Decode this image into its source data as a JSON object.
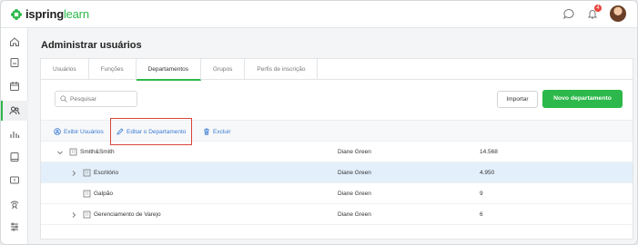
{
  "brand": {
    "word1": "ispring",
    "word2": "learn"
  },
  "header": {
    "notification_count": "4"
  },
  "page": {
    "title": "Administrar usuários"
  },
  "tabs": [
    {
      "label": "Usuários"
    },
    {
      "label": "Funções"
    },
    {
      "label": "Departamentos"
    },
    {
      "label": "Grupos"
    },
    {
      "label": "Perfis de inscrição"
    }
  ],
  "toolbar": {
    "search_placeholder": "Pesquisar",
    "import_label": "Importar",
    "new_department_label": "Novo departamento"
  },
  "actions": {
    "view_users": "Exibir Usuários",
    "edit_department": "Editar o Departamento",
    "delete": "Excluir"
  },
  "rows": [
    {
      "name": "Smith&Smith",
      "manager": "Diane Green",
      "count": "14.568"
    },
    {
      "name": "Escritório",
      "manager": "Diane Green",
      "count": "4.950"
    },
    {
      "name": "Galpão",
      "manager": "Diane Green",
      "count": "9"
    },
    {
      "name": "Gerenciamento de Varejo",
      "manager": "Diane Green",
      "count": "6"
    }
  ],
  "colors": {
    "accent": "#2cb84a",
    "link": "#3a7bd5",
    "highlight_border": "#d9443d",
    "selected_row": "#e3f0fb"
  }
}
